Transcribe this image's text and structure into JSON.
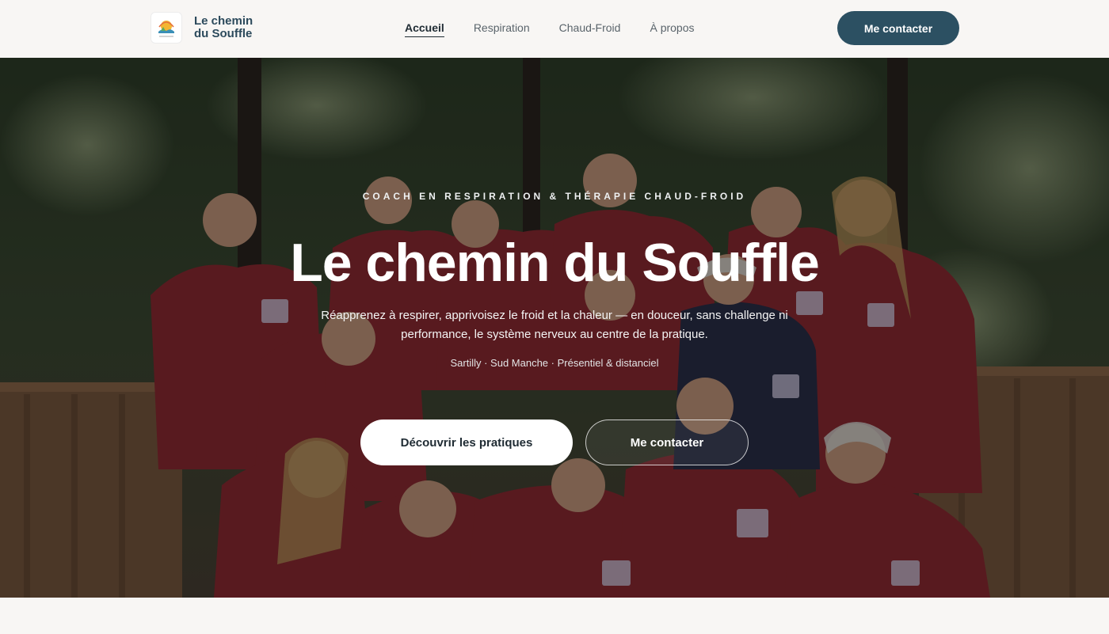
{
  "brand": {
    "name": "Le chemin du Souffle",
    "logo_icon": "sun-landscape-logo"
  },
  "nav": {
    "items": [
      {
        "label": "Accueil",
        "active": true
      },
      {
        "label": "Respiration",
        "active": false
      },
      {
        "label": "Chaud-Froid",
        "active": false
      },
      {
        "label": "À propos",
        "active": false
      }
    ]
  },
  "header": {
    "cta_label": "Me contacter"
  },
  "hero": {
    "eyebrow": "COACH EN RESPIRATION & THÉRAPIE CHAUD-FROID",
    "title": "Le chemin du Souffle",
    "subtitle": "Réapprenez à respirer, apprivoisez le froid et la chaleur — en douceur, sans challenge ni performance, le système nerveux au centre de la pratique.",
    "location": "Sartilly · Sud Manche · Présentiel & distanciel",
    "primary_button": "Découvrir les pratiques",
    "secondary_button": "Me contacter",
    "background": "group-photo-red-shirts-forest"
  },
  "colors": {
    "accent": "#2c5062",
    "page_background": "#f8f6f4",
    "text_dark": "#1f2b33"
  }
}
